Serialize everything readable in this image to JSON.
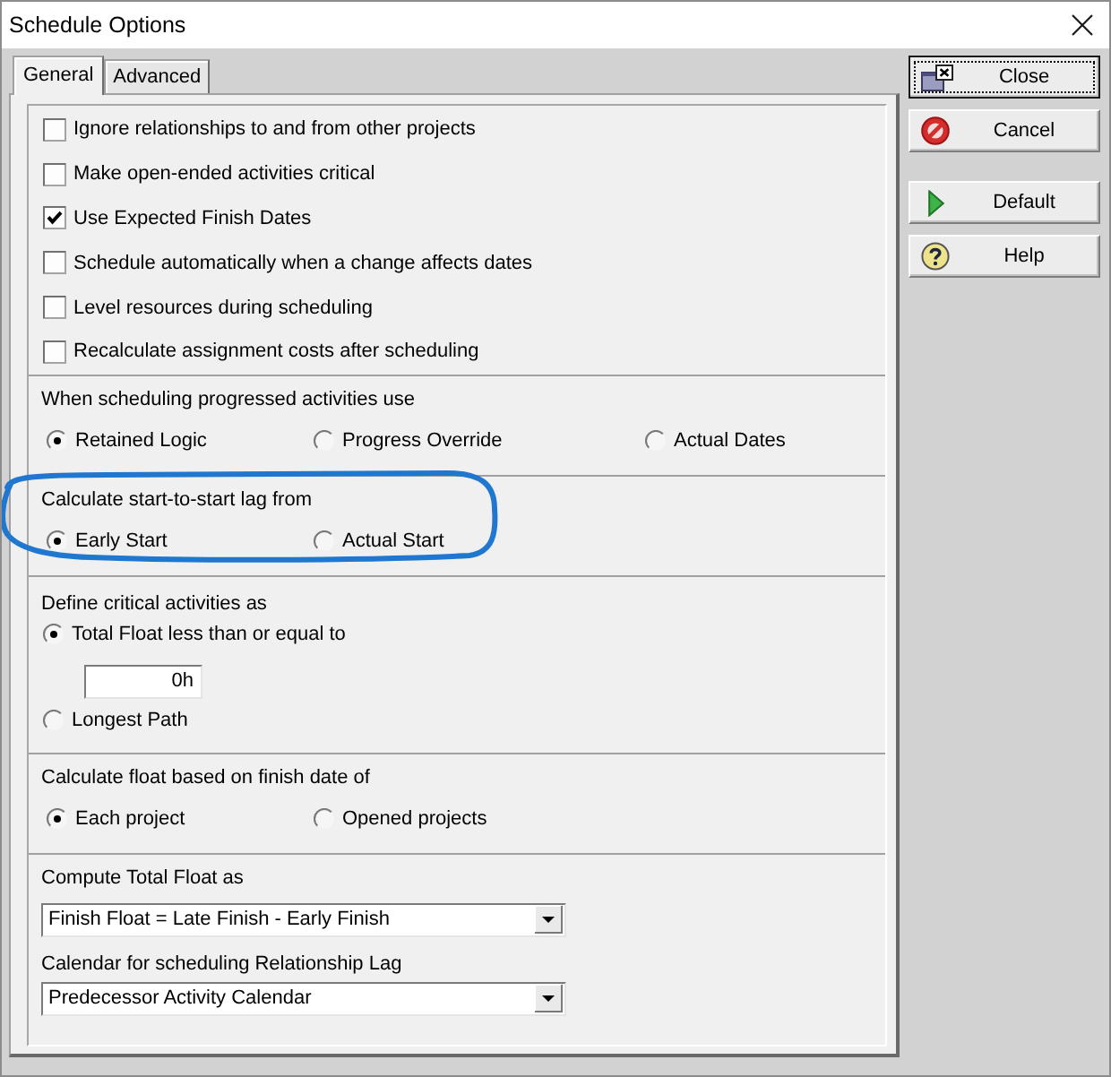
{
  "window": {
    "title": "Schedule Options"
  },
  "tabs": [
    {
      "label": "General",
      "selected": true
    },
    {
      "label": "Advanced",
      "selected": false
    }
  ],
  "scheduling_options": [
    {
      "label": "Ignore relationships to and from other projects",
      "checked": false
    },
    {
      "label": "Make open-ended activities critical",
      "checked": false
    },
    {
      "label": "Use Expected Finish Dates",
      "checked": true
    },
    {
      "label": "Schedule automatically when a change affects dates",
      "checked": false
    },
    {
      "label": "Level resources during scheduling",
      "checked": false
    },
    {
      "label": "Recalculate assignment costs after scheduling",
      "checked": false
    }
  ],
  "option_groups": [
    {
      "kind": "row",
      "label": "When scheduling progressed activities use",
      "circled": false,
      "options": [
        {
          "label": "Retained Logic",
          "selected": true
        },
        {
          "label": "Progress Override",
          "selected": false
        },
        {
          "label": "Actual Dates",
          "selected": false
        }
      ]
    },
    {
      "kind": "row",
      "label": "Calculate start-to-start lag from",
      "circled": true,
      "options": [
        {
          "label": "Early Start",
          "selected": true
        },
        {
          "label": "Actual Start",
          "selected": false
        }
      ]
    },
    {
      "kind": "stack",
      "label": "Define critical activities as",
      "circled": false,
      "options": [
        {
          "label": "Total Float less than or equal to",
          "selected": true,
          "field_value": "0h"
        },
        {
          "label": "Longest Path",
          "selected": false
        }
      ]
    },
    {
      "kind": "row",
      "label": "Calculate float based on finish date of",
      "circled": false,
      "options": [
        {
          "label": "Each project",
          "selected": true
        },
        {
          "label": "Opened projects",
          "selected": false
        }
      ]
    }
  ],
  "dropdowns": [
    {
      "label": "Compute Total Float as",
      "value": "Finish Float = Late Finish - Early Finish"
    },
    {
      "label": "Calendar for scheduling Relationship Lag",
      "value": "Predecessor Activity Calendar"
    }
  ],
  "button_groups": [
    [
      {
        "label": "Close",
        "kind": "close",
        "focused": true
      },
      {
        "label": "Cancel",
        "kind": "cancel",
        "focused": false
      }
    ],
    [
      {
        "label": "Default",
        "kind": "default",
        "focused": false
      },
      {
        "label": "Help",
        "kind": "help",
        "focused": false
      }
    ]
  ]
}
